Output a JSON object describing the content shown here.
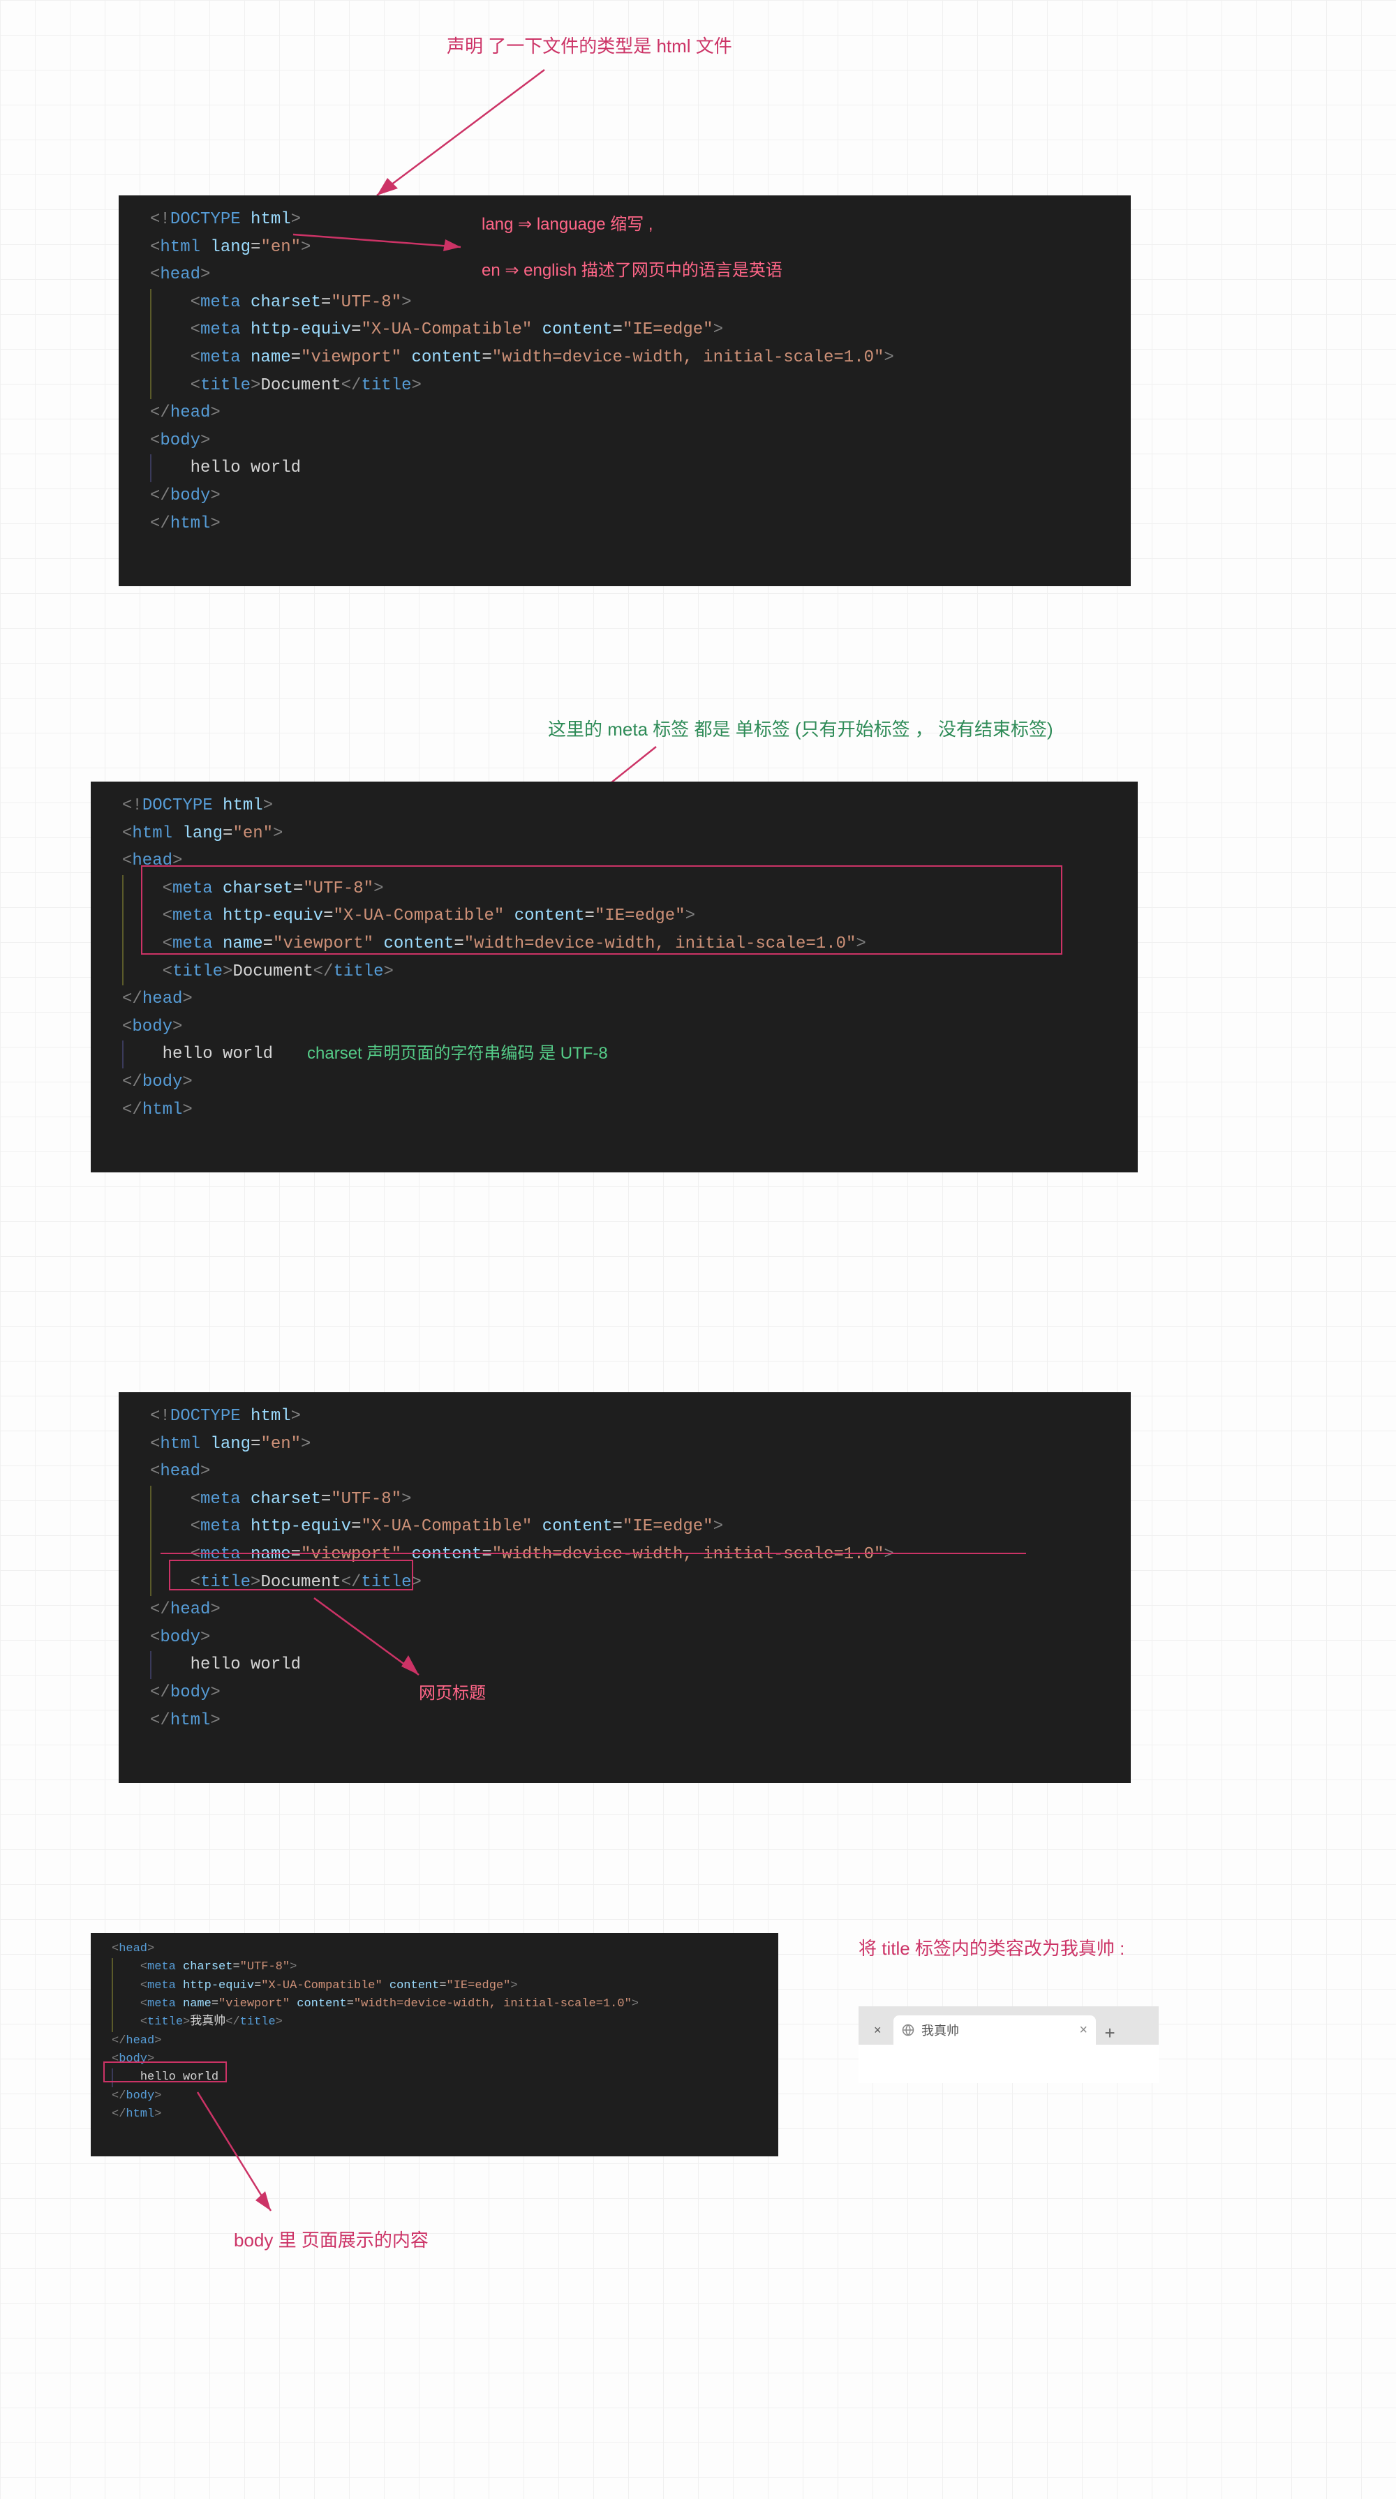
{
  "annotations": {
    "top": "声明 了一下文件的类型是 html 文件",
    "lang1": "lang ⇒ language 缩写 ,",
    "lang2": "en ⇒ english 描述了网页中的语言是英语",
    "meta_single": "这里的 meta 标签 都是 单标签  (只有开始标签 ， 没有结束标签)",
    "charset_note": "charset 声明页面的字符串编码 是 UTF-8",
    "title_note": "网页标题",
    "title_change": "将 title 标签内的类容改为我真帅 :",
    "body_note": "body 里 页面展示的内容"
  },
  "code1": {
    "l1": "<!DOCTYPE html>",
    "l2": "<html lang=\"en\">",
    "l3": "<head>",
    "l4": "    <meta charset=\"UTF-8\">",
    "l5": "    <meta http-equiv=\"X-UA-Compatible\" content=\"IE=edge\">",
    "l6": "    <meta name=\"viewport\" content=\"width=device-width, initial-scale=1.0\">",
    "l7": "    <title>Document</title>",
    "l8": "</head>",
    "l9": "<body>",
    "l10": "    hello world",
    "l11": "</body>",
    "l12": "</html>"
  },
  "code4": {
    "l1": "<head>",
    "l2": "    <meta charset=\"UTF-8\">",
    "l3": "    <meta http-equiv=\"X-UA-Compatible\" content=\"IE=edge\">",
    "l4": "    <meta name=\"viewport\" content=\"width=device-width, initial-scale=1.0\">",
    "l5": "    <title>我真帅</title>",
    "l6": "</head>",
    "l7": "<body>",
    "l8": "    hello world",
    "l9": "</body>",
    "l10": "</html>"
  },
  "tabs": {
    "blank_x": "×",
    "title": "我真帅",
    "close": "×",
    "plus": "+"
  }
}
